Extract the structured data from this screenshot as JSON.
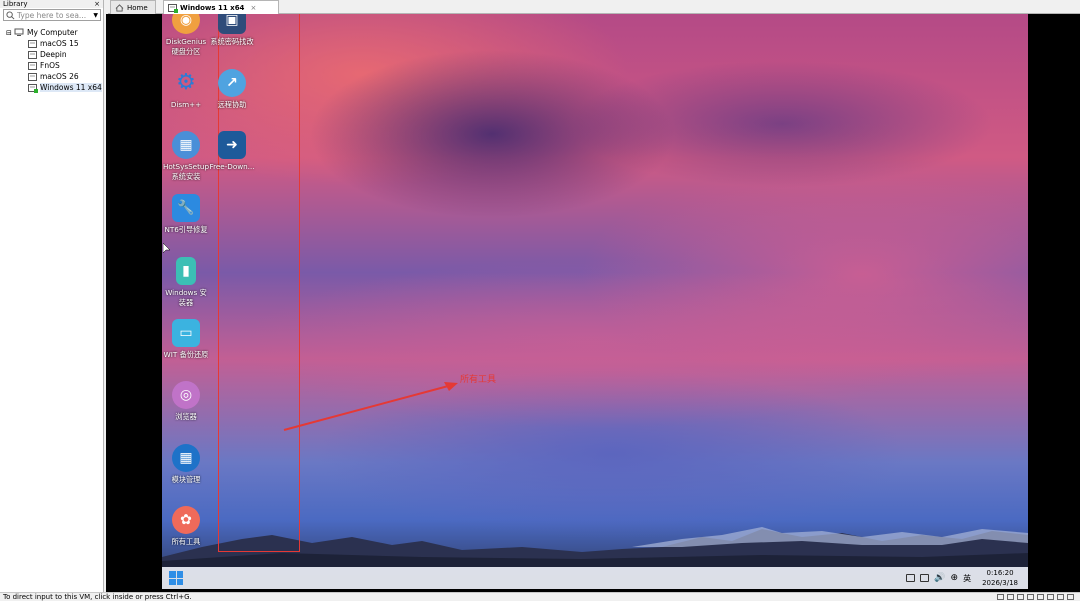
{
  "library": {
    "title": "Library",
    "close": "×",
    "search_placeholder": "Type here to sea...",
    "root": "My Computer",
    "vms": [
      {
        "name": "macOS 15"
      },
      {
        "name": "Deepin"
      },
      {
        "name": "FnOS"
      },
      {
        "name": "macOS 26"
      },
      {
        "name": "Windows 11 x64"
      }
    ]
  },
  "tabs": [
    {
      "label": "Home"
    },
    {
      "label": "Windows 11 x64",
      "close": "×"
    }
  ],
  "desktop_icons": [
    {
      "label": "DiskGenius\n硬盘分区",
      "icon": "diskgenius-icon",
      "color": "#f0a040"
    },
    {
      "label": "系统密码找改",
      "icon": "password-icon",
      "color": "#2f4c7a"
    },
    {
      "label": "Dism++",
      "icon": "gears-icon",
      "color": "#2b7bd6"
    },
    {
      "label": "远程协助",
      "icon": "remote-assist-icon",
      "color": "#4fa3e0"
    },
    {
      "label": "HotSysSetup\n系统安装",
      "icon": "setup-icon",
      "color": "#4a8fd8"
    },
    {
      "label": "Free-Down...",
      "icon": "download-icon",
      "color": "#1e5a9a"
    },
    {
      "label": "NT6引导修复",
      "icon": "wrench-icon",
      "color": "#2c8ae0"
    },
    {
      "label": "Windows 安\n装器",
      "icon": "installer-icon",
      "color": "#3cbfb5"
    },
    {
      "label": "WIT 备份还原",
      "icon": "backup-icon",
      "color": "#3bb3e0"
    },
    {
      "label": "浏览器",
      "icon": "browser-icon",
      "color": "#c073c8"
    },
    {
      "label": "模块管理",
      "icon": "module-icon",
      "color": "#1e72c8"
    },
    {
      "label": "所有工具",
      "icon": "toolbox-icon",
      "color": "#ef6a5a"
    }
  ],
  "annotation": "所有工具",
  "taskbar": {
    "ime": "英",
    "time": "0:16:20",
    "date": "2026/3/18"
  },
  "status": {
    "text": "To direct input to this VM, click inside or press Ctrl+G."
  }
}
